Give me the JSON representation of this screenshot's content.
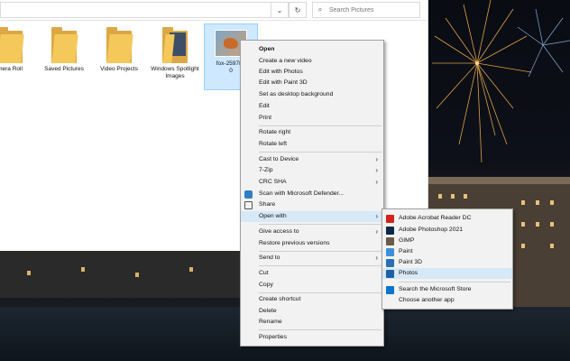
{
  "search": {
    "placeholder": "Search Pictures"
  },
  "address": {
    "refresh_icon": "refresh-icon",
    "dropdown_icon": "chevron-down-icon"
  },
  "items": [
    {
      "label": "mera Roll"
    },
    {
      "label": "Saved Pictures"
    },
    {
      "label": "Video Projects"
    },
    {
      "label": "Windows Spotlight Images"
    },
    {
      "label": "fox-2597803_0",
      "lines": [
        "fox-259780",
        "0"
      ]
    }
  ],
  "context_menu": [
    {
      "label": "Open",
      "bold": true
    },
    {
      "label": "Create a new video"
    },
    {
      "label": "Edit with Photos"
    },
    {
      "label": "Edit with Paint 3D"
    },
    {
      "label": "Set as desktop background"
    },
    {
      "label": "Edit"
    },
    {
      "label": "Print"
    },
    {
      "label": "Rotate right"
    },
    {
      "label": "Rotate left"
    },
    {
      "label": "Cast to Device"
    },
    {
      "label": "7-Zip"
    },
    {
      "label": "CRC SHA"
    },
    {
      "label": "Scan with Microsoft Defender..."
    },
    {
      "label": "Share"
    },
    {
      "label": "Open with"
    },
    {
      "label": "Give access to"
    },
    {
      "label": "Restore previous versions"
    },
    {
      "label": "Send to"
    },
    {
      "label": "Cut"
    },
    {
      "label": "Copy"
    },
    {
      "label": "Create shortcut"
    },
    {
      "label": "Delete"
    },
    {
      "label": "Rename"
    },
    {
      "label": "Properties"
    }
  ],
  "open_with_menu": [
    {
      "label": "Adobe Acrobat Reader DC",
      "color": "#d4231b"
    },
    {
      "label": "Adobe Photoshop 2021",
      "color": "#0b2a4a"
    },
    {
      "label": "GIMP",
      "color": "#6b5a48"
    },
    {
      "label": "Paint",
      "color": "#3f8fd6"
    },
    {
      "label": "Paint 3D",
      "color": "#2d6fb8"
    },
    {
      "label": "Photos",
      "color": "#1f5fa8"
    },
    {
      "label": "Search the Microsoft Store",
      "color": "#0a74cf"
    },
    {
      "label": "Choose another app",
      "color": ""
    }
  ]
}
